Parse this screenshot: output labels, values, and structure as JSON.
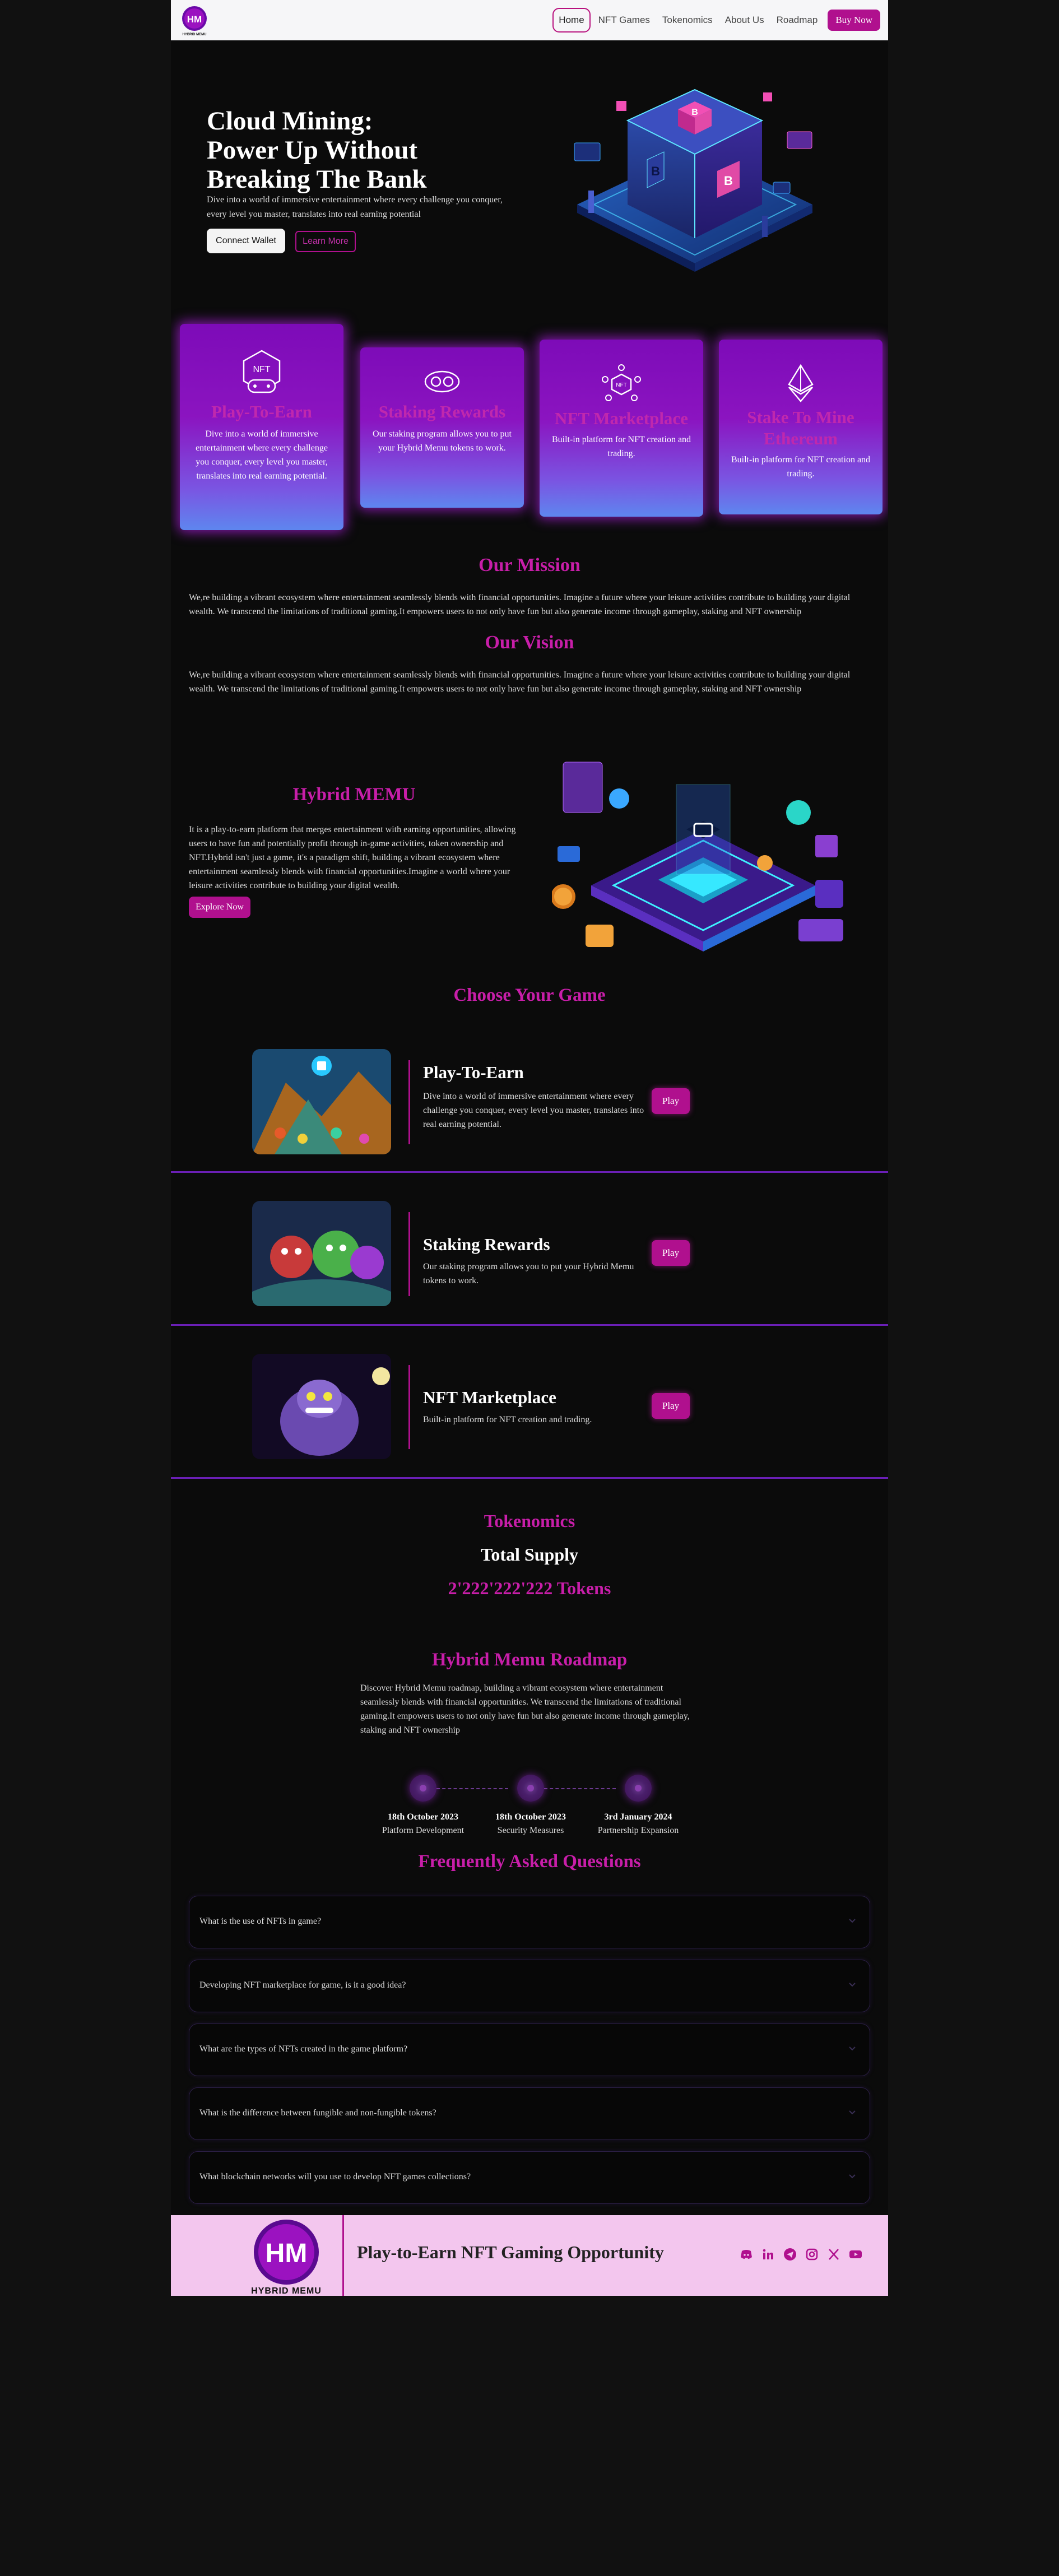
{
  "nav": {
    "logo_text": "HYBRID MEMU",
    "logo_mark": "HM",
    "links": [
      "Home",
      "NFT Games",
      "Tokenomics",
      "About Us",
      "Roadmap"
    ],
    "buy_label": "Buy Now"
  },
  "hero": {
    "title_line1": "Cloud Mining:",
    "title_line2": "Power Up Without",
    "title_line3": "Breaking The Bank",
    "text": "Dive into a world of immersive entertainment where every challenge you conquer, every level you master, translates into real earning potential",
    "connect_label": "Connect Wallet",
    "learn_label": "Learn More"
  },
  "features": [
    {
      "icon": "nft-gamepad-icon",
      "title": "Play-To-Earn",
      "text": "Dive into a world of immersive entertainment where every challenge you conquer, every level you master, translates into real earning potential."
    },
    {
      "icon": "coins-eye-icon",
      "title": "Staking Rewards",
      "text": "Our staking program allows you to put your Hybrid Memu tokens to work."
    },
    {
      "icon": "nft-network-icon",
      "title": "NFT Marketplace",
      "text": "Built-in platform for NFT creation and trading."
    },
    {
      "icon": "ethereum-icon",
      "title": "Stake To Mine Ethereum",
      "text": "Built-in platform for NFT creation and trading."
    }
  ],
  "mission": {
    "title": "Our Mission",
    "text": "We,re building a vibrant ecosystem where entertainment seamlessly blends with financial opportunities. Imagine a future where your leisure activities contribute to building your digital wealth. We transcend the limitations of traditional gaming.It empowers users to not only have fun but also generate income through gameplay, staking and NFT ownership"
  },
  "vision": {
    "title": "Our Vision",
    "text": "We,re building a vibrant ecosystem where entertainment seamlessly blends with financial opportunities. Imagine a future where your leisure activities contribute to building your digital wealth. We transcend the limitations of traditional gaming.It empowers users to not only have fun but also generate income through gameplay, staking and NFT ownership"
  },
  "hybrid": {
    "title": "Hybrid MEMU",
    "text": "It is a play-to-earn platform that merges entertainment with earning opportunities, allowing users to have fun and potentially profit through in-game activities, token ownership and NFT.Hybrid isn't just a game, it's a paradigm shift, building a vibrant ecosystem where entertainment seamlessly blends with financial opportunities.Imagine a world where your leisure activities contribute to building your digital wealth.",
    "explore_label": "Explore Now"
  },
  "games": {
    "title": "Choose Your Game",
    "play_label": "Play",
    "items": [
      {
        "name": "Play-To-Earn",
        "desc": "Dive into a world of immersive entertainment where every challenge you conquer, every level you master, translates into real earning potential."
      },
      {
        "name": "Staking Rewards",
        "desc": "Our staking program allows you to put your Hybrid Memu tokens to work."
      },
      {
        "name": "NFT Marketplace",
        "desc": "Built-in platform for NFT creation and trading."
      }
    ]
  },
  "tokenomics": {
    "title": "Tokenomics",
    "supply_label": "Total Supply",
    "supply_value": "2'222'222'222 Tokens"
  },
  "roadmap": {
    "title": "Hybrid Memu Roadmap",
    "text": "Discover Hybrid Memu roadmap, building a vibrant ecosystem where entertainment seamlessly blends with financial opportunities. We transcend the limitations of traditional gaming.It empowers users to not only have fun but also generate income through gameplay, staking and NFT ownership",
    "milestones": [
      {
        "date": "18th October 2023",
        "label": "Platform Development"
      },
      {
        "date": "18th October 2023",
        "label": "Security Measures"
      },
      {
        "date": "3rd January 2024",
        "label": "Partnership Expansion"
      }
    ]
  },
  "faq": {
    "title": "Frequently Asked Questions",
    "items": [
      "What is the use of NFTs in game?",
      "Developing NFT marketplace for game, is it a good idea?",
      "What are the types of NFTs created in the game platform?",
      "What is the difference between fungible and non-fungible tokens?",
      "What blockchain networks will you use to develop NFT games collections?"
    ]
  },
  "footer": {
    "logo_text": "HYBRID MEMU",
    "logo_mark": "HM",
    "title": "Play-to-Earn NFT Gaming Opportunity",
    "socials": [
      "discord-icon",
      "linkedin-icon",
      "telegram-icon",
      "instagram-icon",
      "x-icon",
      "youtube-icon"
    ]
  },
  "colors": {
    "accent": "#b0108e",
    "heading": "#c81ea9",
    "card_top": "#7d0bb8",
    "card_bottom": "#5e86ef",
    "footer_bg": "#f3c6ee"
  }
}
